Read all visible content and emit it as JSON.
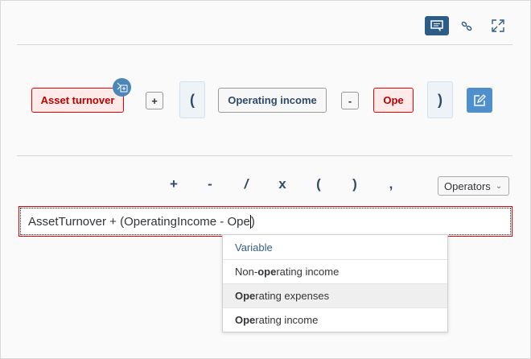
{
  "toolbar": {
    "icons": [
      "comment-icon",
      "unlink-icon",
      "expand-icon"
    ],
    "accent": "#2c5d86"
  },
  "tokens": [
    {
      "label": "Asset turnover",
      "state": "error"
    },
    {
      "label": "+"
    },
    {
      "label": "("
    },
    {
      "label": "Operating income",
      "state": "ok"
    },
    {
      "label": "-"
    },
    {
      "label": "Ope",
      "state": "error"
    },
    {
      "label": ")"
    }
  ],
  "operators": {
    "keys": [
      "+",
      "-",
      "/",
      "x",
      "(",
      ")",
      ","
    ],
    "dropdown_label": "Operators"
  },
  "formula": {
    "value_before": "AssetTurnover + (OperatingIncome - Ope",
    "value_after": ")"
  },
  "suggestions": {
    "header": "Variable",
    "items": [
      {
        "pre": "Non-",
        "bold": "ope",
        "post": "rating income"
      },
      {
        "pre": "",
        "bold": "Ope",
        "post": "rating expenses",
        "highlighted": true
      },
      {
        "pre": "",
        "bold": "Ope",
        "post": "rating income"
      }
    ]
  }
}
